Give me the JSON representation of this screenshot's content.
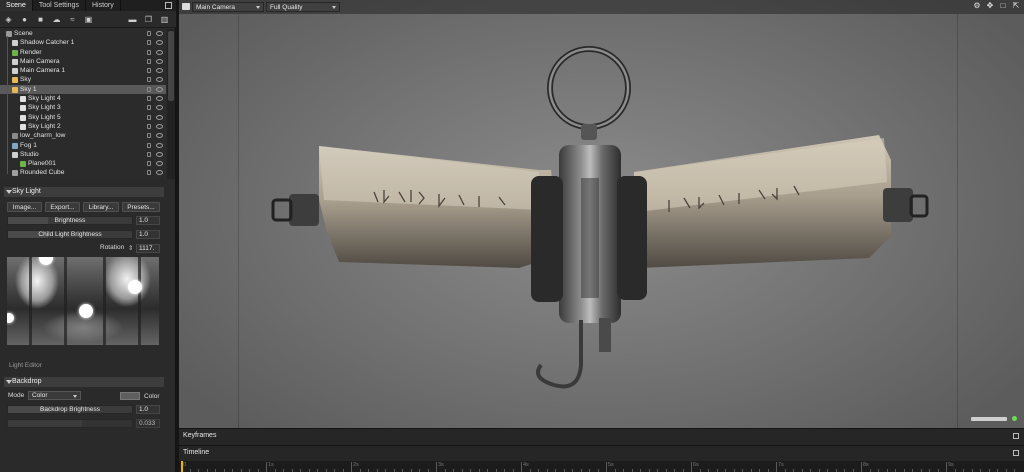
{
  "left_panel": {
    "tabs": [
      {
        "label": "Scene"
      },
      {
        "label": "Tool Settings"
      },
      {
        "label": "History"
      }
    ],
    "scene_tree": [
      {
        "label": "Scene",
        "icon": "scene-icon"
      },
      {
        "label": "Shadow Catcher 1",
        "icon": "shadow-catcher-icon"
      },
      {
        "label": "Render",
        "icon": "render-icon"
      },
      {
        "label": "Main Camera",
        "icon": "camera-icon"
      },
      {
        "label": "Main Camera 1",
        "icon": "camera-icon"
      },
      {
        "label": "Sky",
        "icon": "sky-icon"
      },
      {
        "label": "Sky 1",
        "icon": "sky-icon",
        "selected": true
      },
      {
        "label": "Sky Light 4",
        "icon": "light-icon"
      },
      {
        "label": "Sky Light 3",
        "icon": "light-icon"
      },
      {
        "label": "Sky Light 5",
        "icon": "light-icon"
      },
      {
        "label": "Sky Light 2",
        "icon": "light-icon"
      },
      {
        "label": "low_charm_low",
        "icon": "mesh-icon"
      },
      {
        "label": "Fog 1",
        "icon": "fog-icon"
      },
      {
        "label": "Studio",
        "icon": "studio-icon"
      },
      {
        "label": "Plane001",
        "icon": "mesh-icon"
      },
      {
        "label": "Rounded Cube",
        "icon": "mesh-icon"
      }
    ],
    "sky_light": {
      "header": "Sky Light",
      "image_button": "Image...",
      "export_button": "Export...",
      "library_button": "Library...",
      "presets_button": "Presets...",
      "brightness_label": "Brightness",
      "brightness_value": "1.0",
      "child_brightness_label": "Child Light Brightness",
      "child_brightness_value": "1.0",
      "rotation_label": "Rotation",
      "rotation_value": "1117.",
      "light_editor_label": "Light Editor"
    },
    "backdrop": {
      "header": "Backdrop",
      "mode_label": "Mode",
      "mode_value": "Color",
      "color_label": "Color",
      "brightness_label": "Backdrop Brightness",
      "brightness_value": "1.0",
      "second_value": "0.033"
    }
  },
  "viewport": {
    "camera_select": "Main Camera",
    "quality_select": "Full Quality"
  },
  "bottom": {
    "keyframes_label": "Keyframes",
    "timeline_label": "Timeline",
    "ruler_labels": [
      "0",
      "1s",
      "2s",
      "3s",
      "4s",
      "5s",
      "6s",
      "7s",
      "8s",
      "9s"
    ]
  },
  "colors": {
    "selection": "#595959",
    "status_ok": "#6fdc55",
    "playhead": "#e6b800"
  }
}
